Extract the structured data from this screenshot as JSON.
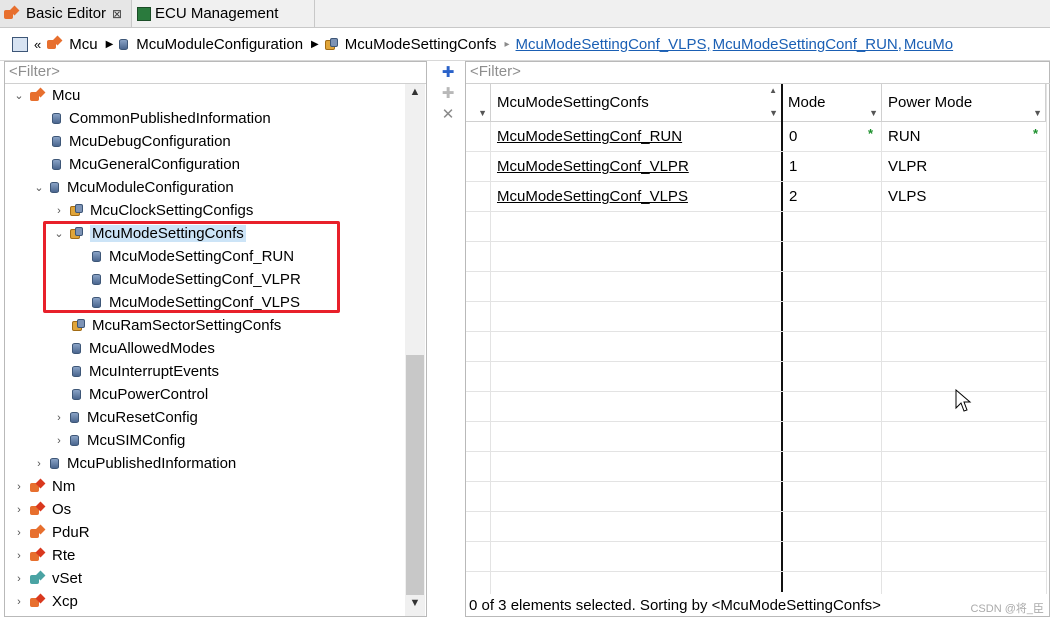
{
  "tabs": [
    {
      "label": "Basic Editor",
      "close": "⊠",
      "active": true
    },
    {
      "label": "ECU Management",
      "active": false
    }
  ],
  "breadcrumb": {
    "items": [
      "Mcu",
      "McuModuleConfiguration",
      "McuModeSettingConfs"
    ],
    "links": [
      "McuModeSettingConf_VLPS,",
      "McuModeSettingConf_RUN,",
      "McuMo"
    ]
  },
  "left": {
    "filter_placeholder": "<Filter>",
    "tree": [
      {
        "label": "Mcu",
        "twisty": "⌄",
        "icon": "mcu-module-icon"
      },
      {
        "label": "CommonPublishedInformation",
        "icon": "container-icon"
      },
      {
        "label": "McuDebugConfiguration",
        "icon": "container-icon"
      },
      {
        "label": "McuGeneralConfiguration",
        "icon": "container-icon"
      },
      {
        "label": "McuModuleConfiguration",
        "twisty": "⌄",
        "icon": "container-icon"
      },
      {
        "label": "McuClockSettingConfigs",
        "twisty": "›",
        "icon": "list-container-icon"
      },
      {
        "label": "McuModeSettingConfs",
        "twisty": "⌄",
        "icon": "list-container-icon"
      },
      {
        "label": "McuModeSettingConf_RUN",
        "icon": "container-icon"
      },
      {
        "label": "McuModeSettingConf_VLPR",
        "icon": "container-icon"
      },
      {
        "label": "McuModeSettingConf_VLPS",
        "icon": "container-icon"
      },
      {
        "label": "McuRamSectorSettingConfs",
        "icon": "list-container-icon"
      },
      {
        "label": "McuAllowedModes",
        "icon": "container-icon"
      },
      {
        "label": "McuInterruptEvents",
        "icon": "container-icon"
      },
      {
        "label": "McuPowerControl",
        "icon": "container-icon"
      },
      {
        "label": "McuResetConfig",
        "twisty": "›",
        "icon": "container-icon"
      },
      {
        "label": "McuSIMConfig",
        "twisty": "›",
        "icon": "container-icon"
      },
      {
        "label": "McuPublishedInformation",
        "twisty": "›",
        "icon": "container-icon"
      },
      {
        "label": "Nm",
        "twisty": "›",
        "icon": "module-error-icon"
      },
      {
        "label": "Os",
        "twisty": "›",
        "icon": "module-error-icon"
      },
      {
        "label": "PduR",
        "twisty": "›",
        "icon": "module-warning-icon"
      },
      {
        "label": "Rte",
        "twisty": "›",
        "icon": "module-error-icon"
      },
      {
        "label": "vSet",
        "twisty": "›",
        "icon": "vset-module-icon"
      },
      {
        "label": "Xcp",
        "twisty": "›",
        "icon": "module-error-icon"
      }
    ]
  },
  "right": {
    "filter_placeholder": "<Filter>",
    "columns": [
      "McuModeSettingConfs",
      "Mode",
      "Power Mode"
    ],
    "rows": [
      {
        "name": "McuModeSettingConf_RUN",
        "mode": "0",
        "power": "RUN"
      },
      {
        "name": "McuModeSettingConf_VLPR",
        "mode": "1",
        "power": "VLPR"
      },
      {
        "name": "McuModeSettingConf_VLPS",
        "mode": "2",
        "power": "VLPS"
      }
    ],
    "required_marker": "*",
    "status": "0 of 3 elements selected. Sorting by <McuModeSettingConfs>"
  },
  "watermark": "CSDN @将_臣",
  "colors": {
    "highlight": "#e8202a",
    "link": "#1a5fb4",
    "selection": "#cce4f7"
  }
}
